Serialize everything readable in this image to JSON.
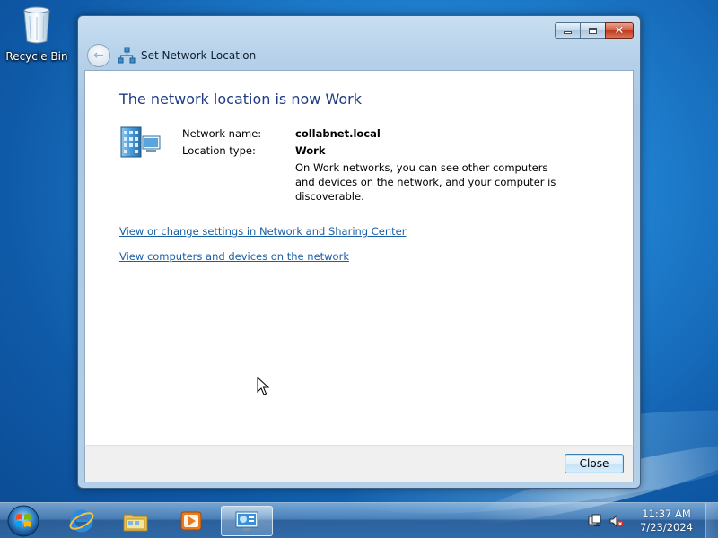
{
  "desktop": {
    "icons": [
      {
        "label": "Recycle Bin",
        "icon": "recycle-bin-icon"
      }
    ]
  },
  "window": {
    "title": "Set Network Location",
    "heading": "The network location is now Work",
    "network_name_label": "Network name:",
    "network_name_value": "collabnet.local",
    "location_type_label": "Location type:",
    "location_type_value": "Work",
    "description": "On Work networks, you can see other computers and devices on the network, and your computer is discoverable.",
    "links": [
      "View or change settings in Network and Sharing Center",
      "View computers and devices on the network"
    ],
    "close_button": "Close"
  },
  "taskbar": {
    "items": [
      {
        "icon": "start-orb-icon"
      },
      {
        "icon": "internet-explorer-icon"
      },
      {
        "icon": "windows-explorer-icon"
      },
      {
        "icon": "media-player-icon"
      },
      {
        "icon": "network-location-icon",
        "active": true
      }
    ],
    "tray": {
      "icons": [
        "action-center-icon",
        "volume-muted-icon"
      ],
      "time": "11:37 AM",
      "date": "7/23/2024"
    }
  },
  "colors": {
    "heading": "#1e3b86",
    "link": "#1a5fa5",
    "desktop": "#1f7fcf"
  }
}
